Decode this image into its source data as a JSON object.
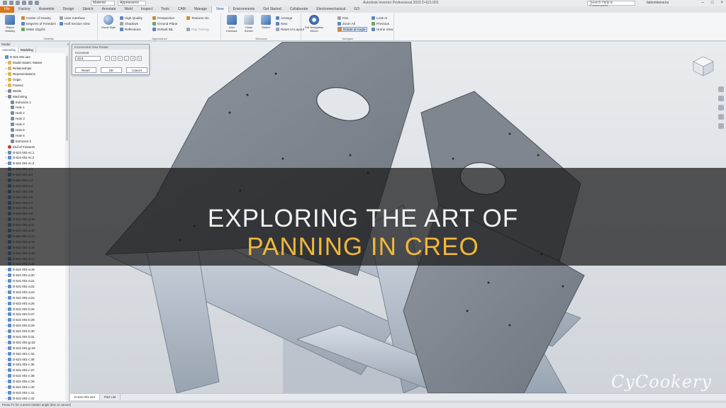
{
  "window": {
    "title": "Autodesk Inventor Professional 2022    D-621-001",
    "search_placeholder": "Search Help & Commands...",
    "user": "fabiomteixeira",
    "material": "Material",
    "appearance": "Appearance"
  },
  "tabs": [
    "File",
    "Factory",
    "Assemble",
    "Design",
    "Sketch",
    "Annotate",
    "Weld",
    "Inspect",
    "Tools",
    "CAM",
    "Manage",
    "View",
    "Environments",
    "Get Started",
    "Collaborate",
    "Electromechanical",
    "GO"
  ],
  "ribbon": {
    "visibility": {
      "big_label": "Object Visibility",
      "items": [
        "Center of Gravity",
        "Degrees of Freedom",
        "iMate Glyphs"
      ],
      "more": [
        "User Interface",
        "Half Section View"
      ],
      "label": "Visibility"
    },
    "appearance": {
      "visual_style": "Visual Style",
      "items": [
        "High Quality",
        "Shadows",
        "Reflections",
        "Perspective",
        "Ground Plane",
        "Default IBL",
        "Textures On",
        "Ray Tracing"
      ],
      "label": "Appearance"
    },
    "windows": {
      "items": [
        "User Interface",
        "Clean Screen",
        "Switch"
      ],
      "small": [
        "Arrange",
        "New",
        "Reset UI Layout"
      ],
      "label": "Windows"
    },
    "navigate": {
      "wheel": "Full Navigation Wheel",
      "items": [
        "Pan",
        "Zoom All",
        "Rotate at Angle",
        "Look At",
        "Previous",
        "Home View"
      ],
      "label": "Navigate"
    }
  },
  "browser": {
    "title": "Model",
    "tabs": [
      "Assembly",
      "Modeling"
    ],
    "items": [
      "D-621-001.iam",
      "Model States: Master",
      "Relationships",
      "Representations",
      "Origin",
      "Frames",
      "Welds",
      "Machining",
      "Extrusion 1",
      "Hole 1",
      "Hole 2",
      "Hole 3",
      "Hole 4",
      "Hole 5",
      "Hole 6",
      "Extrusion 2",
      "End of Features",
      "D-621-001-sc:1",
      "D-621-001-sc:2",
      "D-621-001-sc:3",
      "D-621-001-a:1",
      "D-621-001-a:2",
      "D-621-001-a:3",
      "D-621-001-a:4",
      "D-621-001-a:5",
      "D-621-001-a:6",
      "D-621-001-a:7",
      "D-621-001-a:8",
      "D-621-001-a:9",
      "D-621-001-a:10",
      "D-621-001-a:11",
      "D-621-001-a:12",
      "D-621-001-a:13",
      "D-621-001-a:14",
      "D-621-001-a:15",
      "D-621-001-a:16",
      "D-621-001-a:17",
      "D-621-001-a:18",
      "D-621-001-a:19",
      "D-621-001-a:20",
      "D-621-001-a:21",
      "D-621-001-a:22",
      "D-621-001-a:23",
      "D-621-001-a:24",
      "D-621-001-a:25",
      "D-621-001-b:26",
      "D-621-001-b:27",
      "D-621-001-b:28",
      "D-621-001-b:29",
      "D-621-001-b:30",
      "D-621-001-b:31",
      "D-621-001-jp:32",
      "D-621-001-jp:33",
      "D-621-001-c:34",
      "D-621-001-c:35",
      "D-621-001-c:36",
      "D-621-001-c:37",
      "D-621-001-c:38",
      "D-621-001-c:39",
      "D-621-001-c:40",
      "D-621-001-c:41",
      "D-621-001-c:42",
      "D-621-001-c:43",
      "D-621-001-c:44",
      "D-621-001-c:45"
    ]
  },
  "dialog": {
    "title": "Incremental View Rotate",
    "label": "Increment",
    "value": "22.5",
    "reset": "Reset",
    "ok": "OK",
    "cancel": "Cancel"
  },
  "doctabs": [
    "D-621-001.iam",
    "Part List"
  ],
  "status": "Press F1 for current rotation angle (Esc to cancel)",
  "banner": {
    "line1": "EXPLORING THE ART OF",
    "line2": "PANNING IN CREO"
  },
  "watermark": "CyCookery",
  "colors": {
    "file_tab": "#d9751a",
    "banner_accent": "#f0b73a"
  }
}
